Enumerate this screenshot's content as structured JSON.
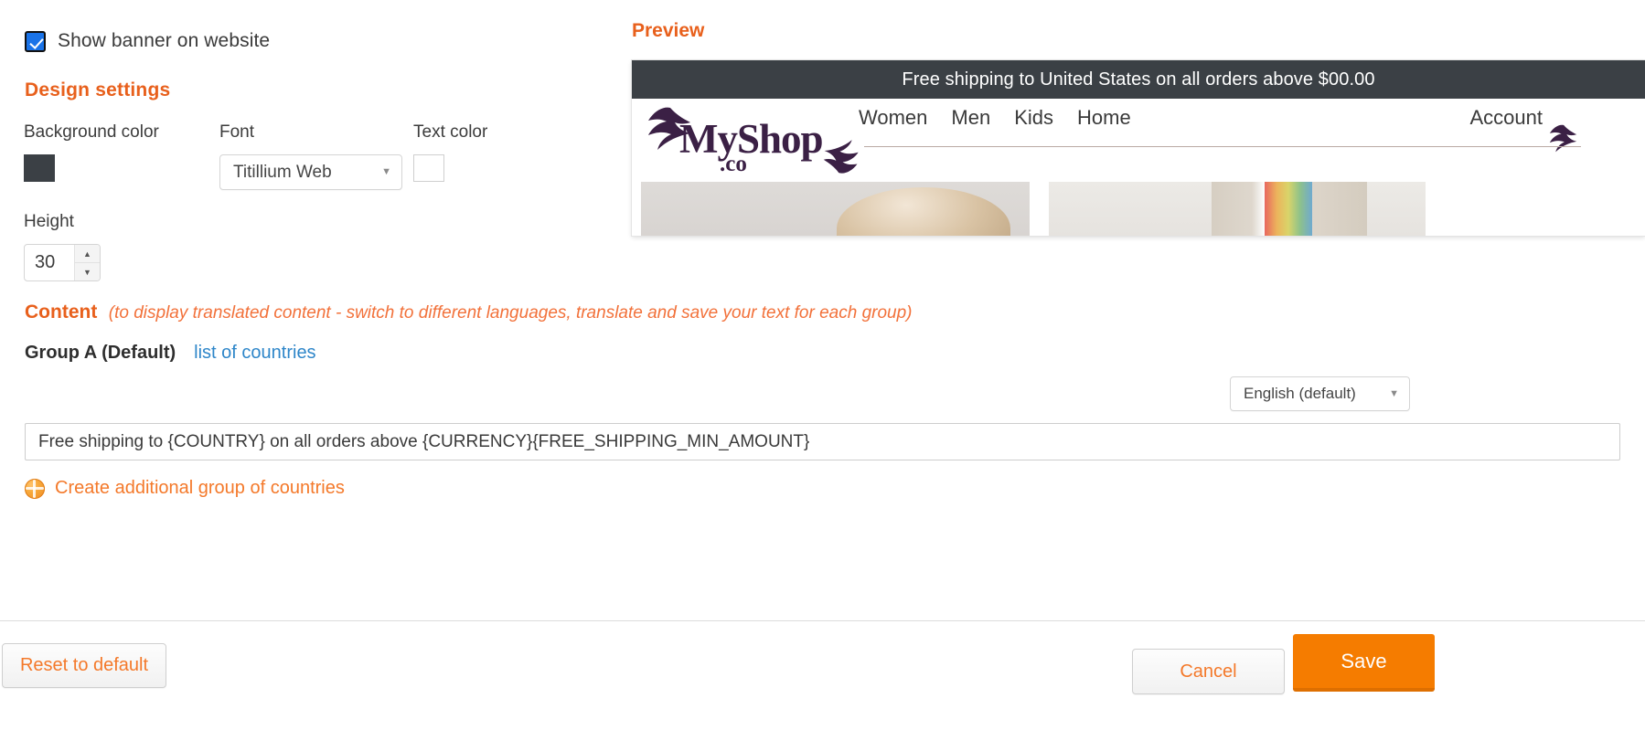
{
  "settings": {
    "show_banner_label": "Show banner on website",
    "show_banner_checked": true,
    "design_settings_title": "Design settings",
    "background_color_label": "Background color",
    "background_color_value": "#3b4045",
    "font_label": "Font",
    "font_value": "Titillium Web",
    "text_color_label": "Text color",
    "text_color_value": "#ffffff",
    "height_label": "Height",
    "height_value": "30"
  },
  "content": {
    "title": "Content",
    "note": "(to display translated content - switch to different languages, translate and save your text for each group)",
    "group_label": "Group A (Default)",
    "countries_link": "list of countries",
    "language_value": "English (default)",
    "message_value": "Free shipping to {COUNTRY} on all orders above {CURRENCY}{FREE_SHIPPING_MIN_AMOUNT}",
    "create_group_label": "Create additional group of countries",
    "globe_icon": "globe-icon"
  },
  "preview": {
    "title": "Preview",
    "banner_text": "Free shipping to United States on all orders above $00.00",
    "banner_bg": "#3b4045",
    "banner_text_color": "#ffffff",
    "logo_text": "MyShop",
    "logo_sub": ".co",
    "logo_color": "#3b2045",
    "nav_items": [
      "Women",
      "Men",
      "Kids",
      "Home"
    ],
    "account_label": "Account"
  },
  "footer": {
    "reset_label": "Reset to default",
    "cancel_label": "Cancel",
    "save_label": "Save",
    "accent_color": "#f4792a",
    "save_bg": "#f57c00"
  }
}
